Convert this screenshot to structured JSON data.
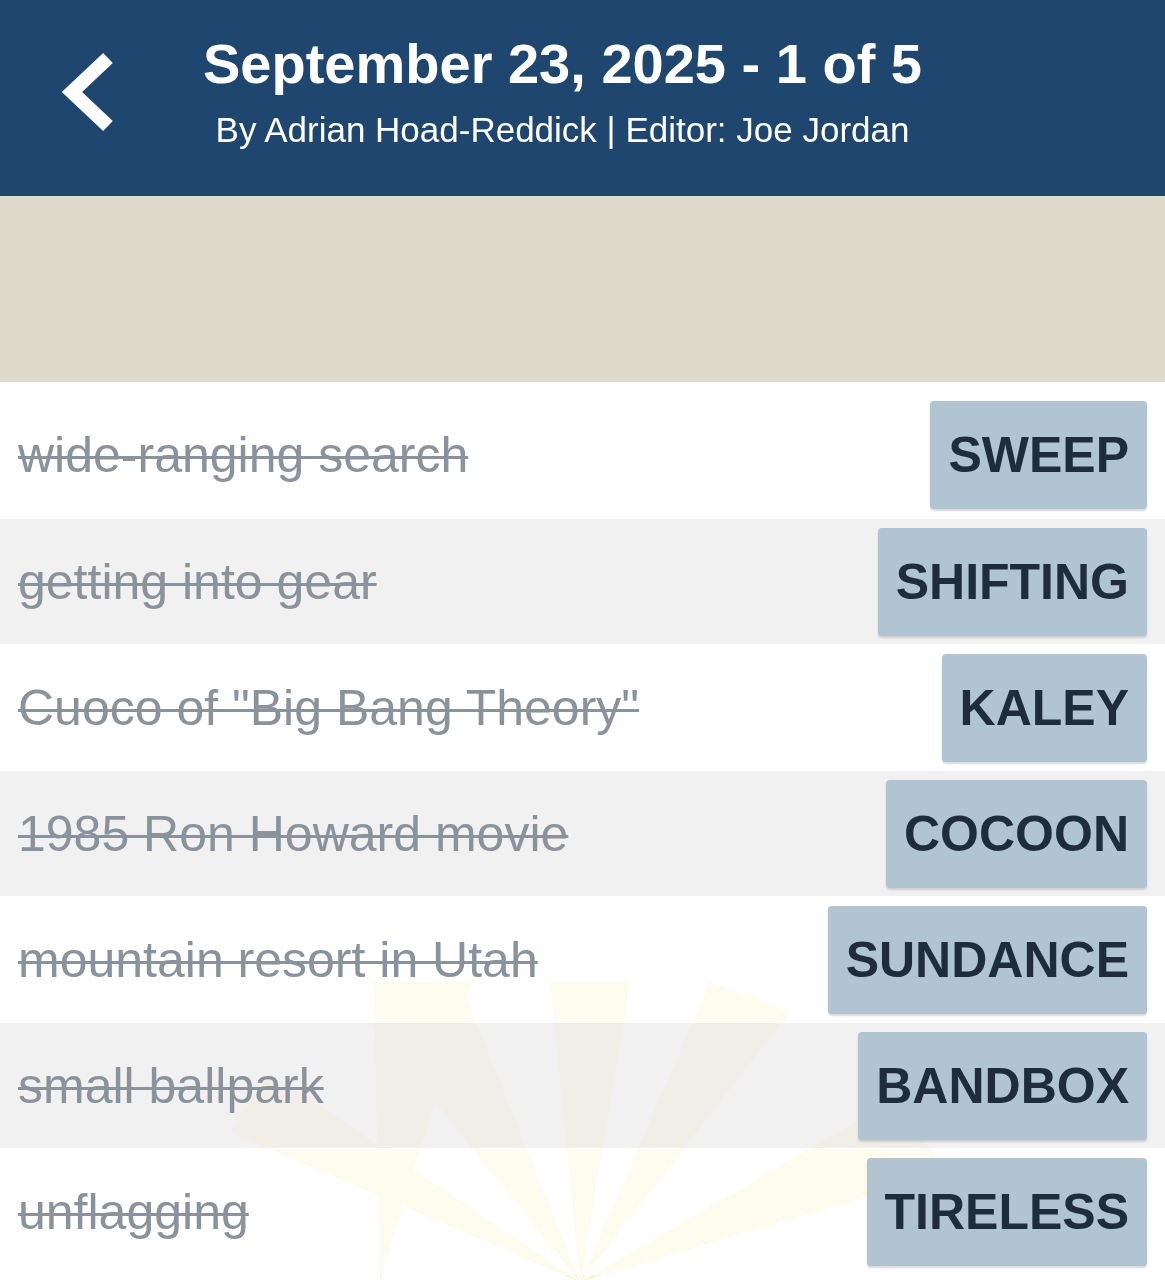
{
  "header": {
    "title": "September 23, 2025 - 1 of 5",
    "byline": "By Adrian Hoad-Reddick | Editor: Joe Jordan"
  },
  "clues": [
    {
      "clue": "wide-ranging search",
      "answer": "SWEEP",
      "solved": true
    },
    {
      "clue": "getting into gear",
      "answer": "SHIFTING",
      "solved": true
    },
    {
      "clue": "Cuoco of \"Big Bang Theory\"",
      "answer": "KALEY",
      "solved": true
    },
    {
      "clue": "1985 Ron Howard movie",
      "answer": "COCOON",
      "solved": true
    },
    {
      "clue": "mountain resort in Utah",
      "answer": "SUNDANCE",
      "solved": true
    },
    {
      "clue": "small ballpark",
      "answer": "BANDBOX",
      "solved": true
    },
    {
      "clue": "unflagging",
      "answer": "TIRELESS",
      "solved": true
    }
  ]
}
